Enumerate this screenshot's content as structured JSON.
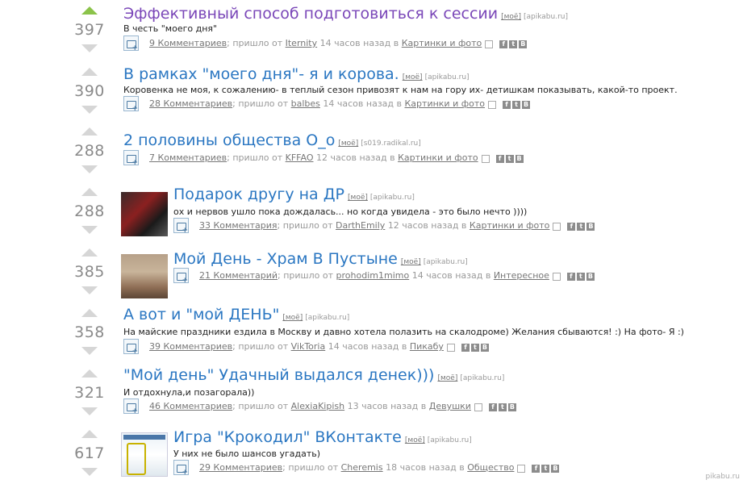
{
  "posts": [
    {
      "score": "397",
      "voted": true,
      "title": "Эффективный способ подготовиться к сессии",
      "visited": true,
      "tag": "[моё]",
      "domain": "[apikabu.ru]",
      "desc": "В честь \"моего дня\"",
      "comments": "9 Комментариев",
      "came_from": "; пришло от",
      "author": "Iternity",
      "time": "14 часов назад в",
      "category": "Картинки и фото",
      "thumb": null
    },
    {
      "score": "390",
      "voted": false,
      "title": "В рамках \"моего дня\"- я и корова.",
      "visited": false,
      "tag": "[моё]",
      "domain": "[apikabu.ru]",
      "desc": "Коровенка не моя, к сожалению- в теплый сезон привозят к нам на гору их- детишкам показывать, какой-то проект.",
      "comments": "28 Комментариев",
      "came_from": "; пришло от",
      "author": "balbes",
      "time": "14 часов назад в",
      "category": "Картинки и фото",
      "thumb": null
    },
    {
      "score": "288",
      "voted": false,
      "title": "2 половины общества О_о",
      "visited": false,
      "tag": "[моё]",
      "domain": "[s019.radikal.ru]",
      "desc": "",
      "comments": "7 Комментариев",
      "came_from": "; пришло от",
      "author": "KFFAO",
      "time": "12 часов назад в",
      "category": "Картинки и фото",
      "thumb": null
    },
    {
      "score": "288",
      "voted": false,
      "title": "Подарок другу на ДР",
      "visited": false,
      "tag": "[моё]",
      "domain": "[apikabu.ru]",
      "desc": "ох и нервов ушло пока дождалась... но когда увидела - это было нечто ))))",
      "comments": "33 Комментария",
      "came_from": "; пришло от",
      "author": "DarthEmily",
      "time": "12 часов назад в",
      "category": "Картинки и фото",
      "thumb": "thumb1"
    },
    {
      "score": "385",
      "voted": false,
      "title": "Мой День - Храм В Пустыне",
      "visited": false,
      "tag": "[моё]",
      "domain": "[apikabu.ru]",
      "desc": "",
      "comments": "21 Комментарий",
      "came_from": "; пришло от",
      "author": "prohodim1mimo",
      "time": "14 часов назад в",
      "category": "Интересное",
      "thumb": "thumb2"
    },
    {
      "score": "358",
      "voted": false,
      "title": "А вот и \"мой ДЕНЬ\"",
      "visited": false,
      "tag": "[моё]",
      "domain": "[apikabu.ru]",
      "desc": "На майские праздники ездила в Москву и давно хотела полазить на скалодроме) Желания сбываются! :) На фото- Я :)",
      "comments": "39 Комментариев",
      "came_from": "; пришло от",
      "author": "VikToria",
      "time": "14 часов назад в",
      "category": "Пикабу",
      "thumb": null
    },
    {
      "score": "321",
      "voted": false,
      "title": "\"Мой день\" Удачный выдался денек)))",
      "visited": false,
      "tag": "[моё]",
      "domain": "[apikabu.ru]",
      "desc": "И отдохнула,и позагорала))",
      "comments": "46 Комментариев",
      "came_from": "; пришло от",
      "author": "AlexiaKipish",
      "time": "13 часов назад в",
      "category": "Девушки",
      "thumb": null
    },
    {
      "score": "617",
      "voted": false,
      "title": "Игра \"Крокодил\" ВКонтакте",
      "visited": false,
      "tag": "[моё]",
      "domain": "[apikabu.ru]",
      "desc": "У них не было шансов угадать)",
      "comments": "29 Комментариев",
      "came_from": "; пришло от",
      "author": "Cheremis",
      "time": "18 часов назад в",
      "category": "Общество",
      "thumb": "thumb3"
    }
  ],
  "social": {
    "f": "f",
    "t": "t",
    "v": "B"
  },
  "watermark": "pikabu.ru"
}
